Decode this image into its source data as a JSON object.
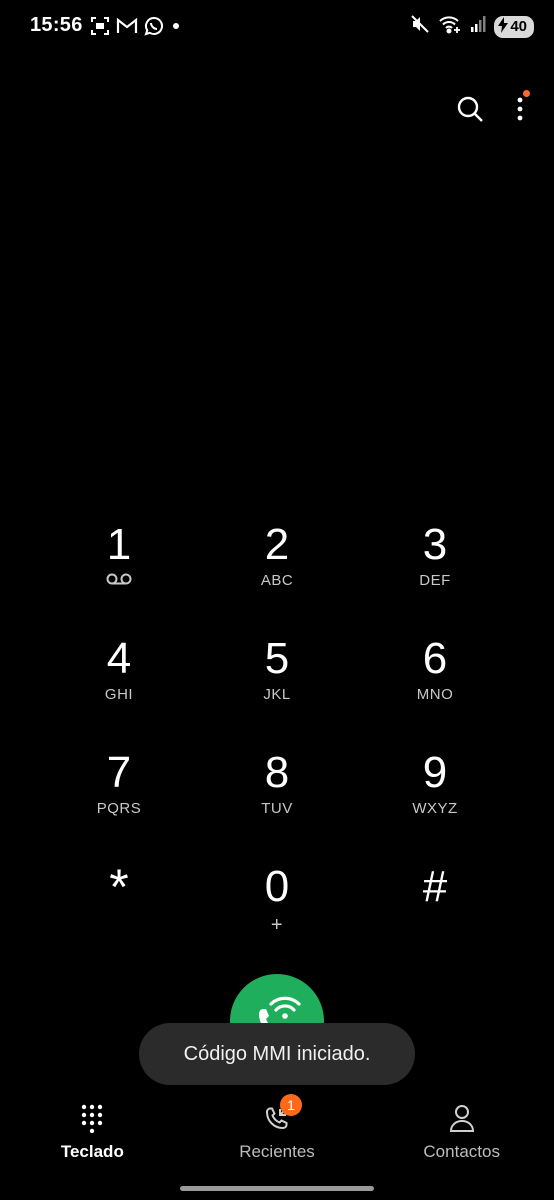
{
  "status_bar": {
    "time": "15:56",
    "battery_level": "40",
    "left_icons": [
      "screenshot-icon",
      "gmail-icon",
      "whatsapp-icon",
      "notification-dot-icon"
    ],
    "right_icons": [
      "mute-icon",
      "wifi-calling-icon",
      "signal-icon",
      "battery-charging-icon"
    ]
  },
  "top_actions": {
    "icons": [
      "search-icon",
      "more-options-icon"
    ],
    "accent_badge_color": "#ff6a2a"
  },
  "keypad": {
    "keys": [
      {
        "digit": "1",
        "letters": "",
        "icon": "voicemail-icon"
      },
      {
        "digit": "2",
        "letters": "ABC"
      },
      {
        "digit": "3",
        "letters": "DEF"
      },
      {
        "digit": "4",
        "letters": "GHI"
      },
      {
        "digit": "5",
        "letters": "JKL"
      },
      {
        "digit": "6",
        "letters": "MNO"
      },
      {
        "digit": "7",
        "letters": "PQRS"
      },
      {
        "digit": "8",
        "letters": "TUV"
      },
      {
        "digit": "9",
        "letters": "WXYZ"
      },
      {
        "digit": "*",
        "letters": ""
      },
      {
        "digit": "0",
        "letters": "+"
      },
      {
        "digit": "#",
        "letters": ""
      }
    ]
  },
  "call_button": {
    "icon": "wifi-call-icon",
    "color": "#1fae5b"
  },
  "toast": {
    "message": "Código MMI iniciado."
  },
  "bottom_nav": {
    "items": [
      {
        "label": "Teclado",
        "icon": "keypad-icon",
        "active": true
      },
      {
        "label": "Recientes",
        "icon": "recents-icon",
        "badge": "1"
      },
      {
        "label": "Contactos",
        "icon": "contacts-icon"
      }
    ]
  }
}
